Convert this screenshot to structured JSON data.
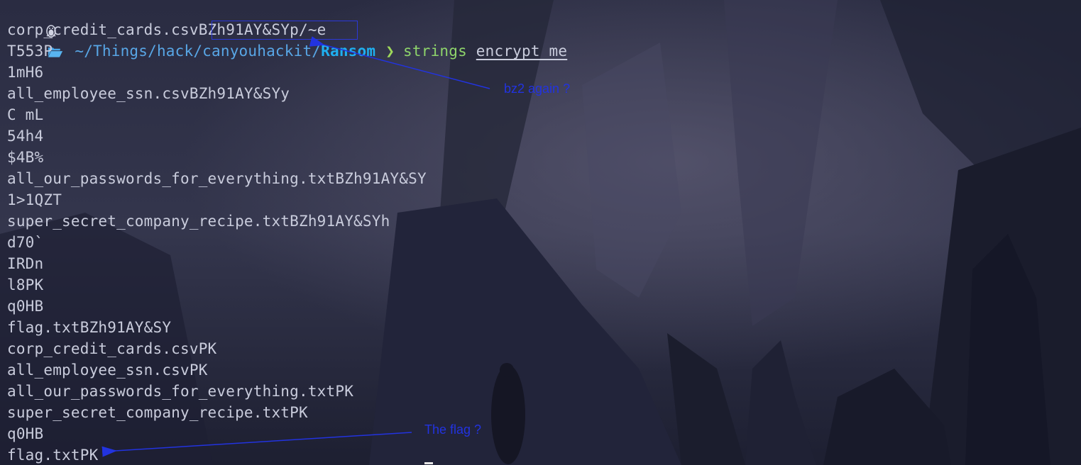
{
  "prompt": {
    "path_prefix": "~/Things/hack/canyouhackit/",
    "path_dir": "Ransom",
    "arrow": "❯",
    "command": "strings",
    "argument": "encrypt_me"
  },
  "output_lines": [
    "corp_credit_cards.csvBZh91AY&SYp/~e",
    "T553P",
    "1mH6",
    "all_employee_ssn.csvBZh91AY&SYy",
    "C mL",
    "54h4",
    "$4B%",
    "all_our_passwords_for_everything.txtBZh91AY&SY",
    "1>1QZT",
    "super_secret_company_recipe.txtBZh91AY&SYh",
    "d70`",
    "IRDn",
    "l8PK",
    "q0HB",
    "flag.txtBZh91AY&SY",
    "corp_credit_cards.csvPK",
    "all_employee_ssn.csvPK",
    "all_our_passwords_for_everything.txtPK",
    "super_secret_company_recipe.txtPK",
    "q0HB",
    "flag.txtPK"
  ],
  "annotations": {
    "bz2": "bz2 again ?",
    "flag": "The flag ?"
  },
  "colors": {
    "annotation": "#2233e0",
    "path": "#58a6e6",
    "command": "#8ed46b",
    "text": "#c9ccdc"
  }
}
